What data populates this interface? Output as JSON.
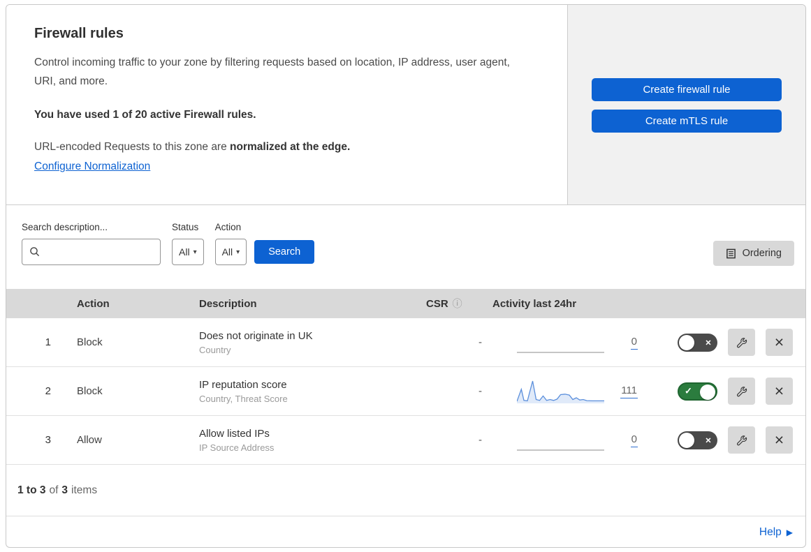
{
  "colors": {
    "accent": "#0d62d2",
    "panel": "#f1f1f1",
    "header-band": "#d9d9d9",
    "green": "#2b7c3e",
    "green-border": "#1f6530",
    "toggle-off": "#4a4a4a",
    "spark-line": "#5b8fdc",
    "spark-fill": "#ccdcf5",
    "link-underline": "#2f6fd1"
  },
  "header": {
    "title": "Firewall rules",
    "description": "Control incoming traffic to your zone by filtering requests based on location, IP address, user agent, URI, and more.",
    "usage": "You have used 1 of 20 active Firewall rules.",
    "normalization_prefix": "URL-encoded Requests to this zone are ",
    "normalization_bold": "normalized at the edge.",
    "config_link": "Configure Normalization",
    "create_firewall_button": "Create firewall rule",
    "create_mtls_button": "Create mTLS rule"
  },
  "filters": {
    "search_label": "Search description...",
    "status_label": "Status",
    "status_value": "All",
    "action_label": "Action",
    "action_value": "All",
    "search_button": "Search",
    "ordering_button": "Ordering"
  },
  "table": {
    "columns": {
      "action": "Action",
      "description": "Description",
      "csr": "CSR",
      "activity": "Activity last 24hr"
    },
    "rows": [
      {
        "num": "1",
        "action": "Block",
        "description": "Does not originate in UK",
        "fields": "Country",
        "csr": "-",
        "count": "0",
        "enabled": false,
        "has_activity": false
      },
      {
        "num": "2",
        "action": "Block",
        "description": "IP reputation score",
        "fields": "Country, Threat Score",
        "csr": "-",
        "count": "111",
        "enabled": true,
        "has_activity": true
      },
      {
        "num": "3",
        "action": "Allow",
        "description": "Allow listed IPs",
        "fields": "IP Source Address",
        "csr": "-",
        "count": "0",
        "enabled": false,
        "has_activity": false
      }
    ],
    "sparkline_points": [
      [
        0,
        0.06
      ],
      [
        0.05,
        0.6
      ],
      [
        0.08,
        0.1
      ],
      [
        0.12,
        0.08
      ],
      [
        0.18,
        0.97
      ],
      [
        0.22,
        0.14
      ],
      [
        0.26,
        0.1
      ],
      [
        0.3,
        0.3
      ],
      [
        0.34,
        0.1
      ],
      [
        0.38,
        0.14
      ],
      [
        0.42,
        0.1
      ],
      [
        0.46,
        0.16
      ],
      [
        0.5,
        0.36
      ],
      [
        0.55,
        0.38
      ],
      [
        0.6,
        0.34
      ],
      [
        0.64,
        0.14
      ],
      [
        0.68,
        0.22
      ],
      [
        0.72,
        0.12
      ],
      [
        0.76,
        0.14
      ],
      [
        0.8,
        0.09
      ],
      [
        0.86,
        0.08
      ],
      [
        0.93,
        0.08
      ],
      [
        1,
        0.08
      ]
    ]
  },
  "footer": {
    "range": "1 to 3",
    "of_label": "of",
    "total": "3",
    "items_label": "items",
    "help_label": "Help"
  }
}
